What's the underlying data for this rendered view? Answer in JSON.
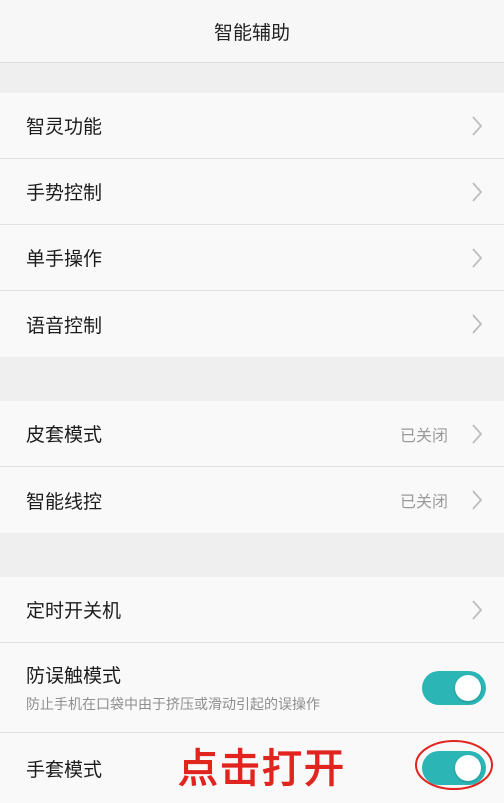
{
  "header": {
    "title": "智能辅助"
  },
  "groups": [
    {
      "items": [
        {
          "label": "智灵功能"
        },
        {
          "label": "手势控制"
        },
        {
          "label": "单手操作"
        },
        {
          "label": "语音控制"
        }
      ]
    },
    {
      "items": [
        {
          "label": "皮套模式",
          "status": "已关闭"
        },
        {
          "label": "智能线控",
          "status": "已关闭"
        }
      ]
    },
    {
      "items": [
        {
          "label": "定时开关机"
        },
        {
          "label": "防误触模式",
          "subtitle": "防止手机在口袋中由于挤压或滑动引起的误操作",
          "toggle_on": true
        },
        {
          "label": "手套模式",
          "toggle_on": true
        }
      ]
    }
  ],
  "annotation": {
    "text": "点击打开"
  },
  "colors": {
    "accent": "#2bb5b5",
    "annotation": "#e0251f"
  },
  "icons": {
    "chevron": "chevron-right-icon"
  }
}
